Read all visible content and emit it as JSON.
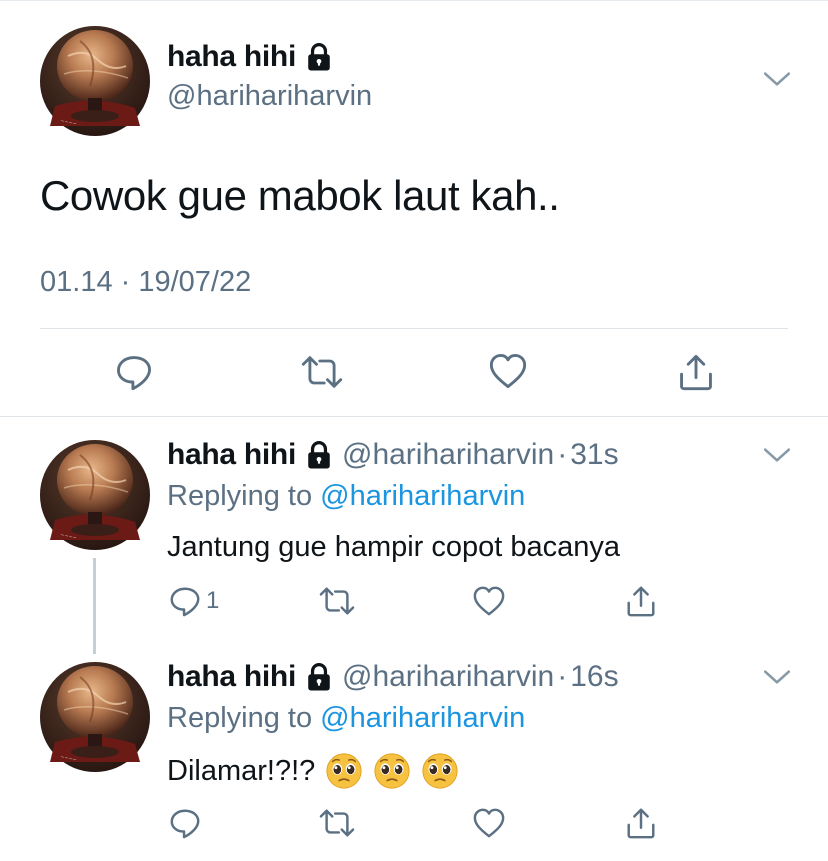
{
  "colors": {
    "link": "#1b95e0",
    "muted": "#5b7083",
    "text": "#0f1419",
    "divider": "#dfe4e8"
  },
  "main_tweet": {
    "display_name": "haha hihi",
    "handle": "@harihariharvin",
    "text": "Cowok gue mabok laut kah..",
    "timestamp": "01.14 · 19/07/22",
    "icons": [
      "lock-icon",
      "chevron-down-icon",
      "reply-icon",
      "retweet-icon",
      "like-icon",
      "share-icon"
    ]
  },
  "replies": [
    {
      "display_name": "haha hihi",
      "handle": "@harihariharvin",
      "dot": "·",
      "time": "31s",
      "replying_prefix": "Replying to",
      "replying_to": "@harihariharvin",
      "text": "Jantung gue hampir copot bacanya",
      "reply_count": "1"
    },
    {
      "display_name": "haha hihi",
      "handle": "@harihariharvin",
      "dot": "·",
      "time": "16s",
      "replying_prefix": "Replying to",
      "replying_to": "@harihariharvin",
      "text": "Dilamar!?!?",
      "emoji": [
        "pleading-face-emoji",
        "pleading-face-emoji",
        "pleading-face-emoji"
      ]
    }
  ]
}
